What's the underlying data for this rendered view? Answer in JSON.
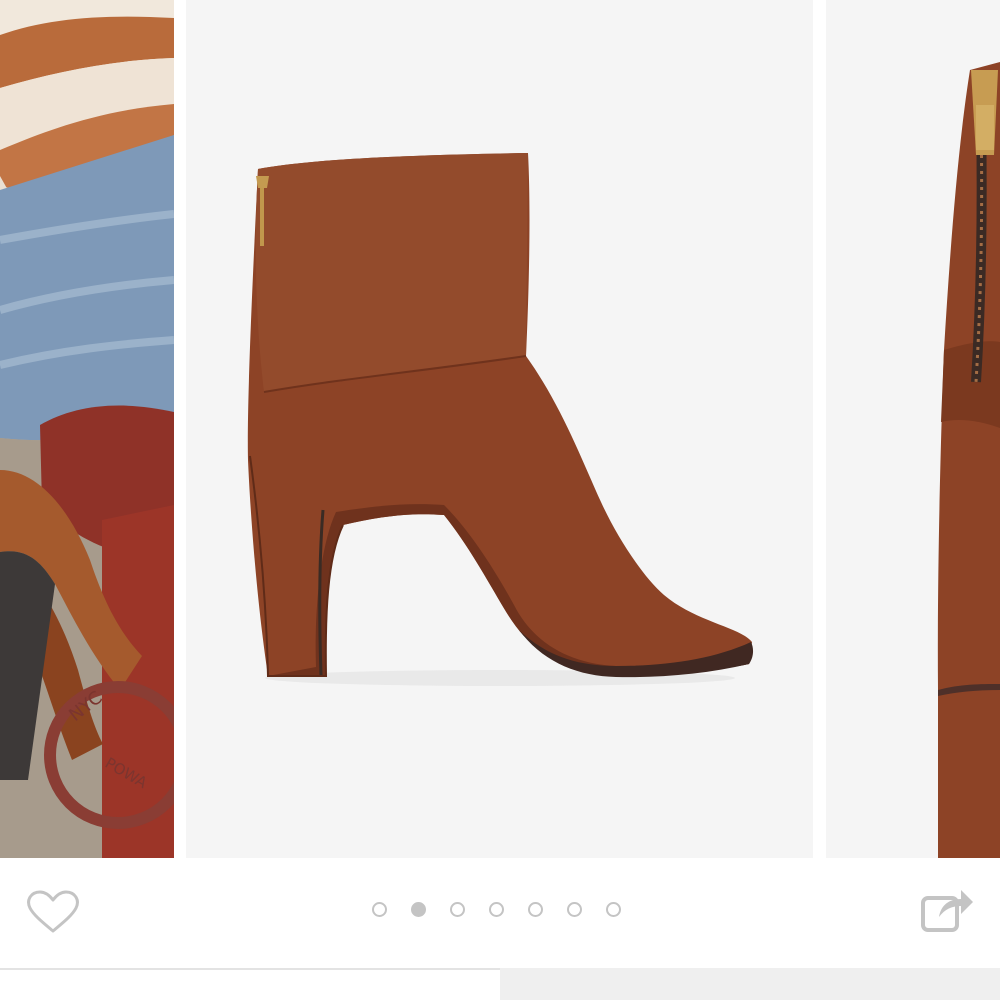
{
  "product_gallery": {
    "total_images": 7,
    "current_image": 2
  },
  "actions": {
    "favorite_icon": "heart-outline-icon",
    "share_icon": "share-arrow-icon"
  },
  "colors": {
    "boot_suede": "#8d4326",
    "gallery_background": "#f5f5f5",
    "inactive_icon": "#c4c4c4",
    "dot_active": "#c4c4c4"
  }
}
